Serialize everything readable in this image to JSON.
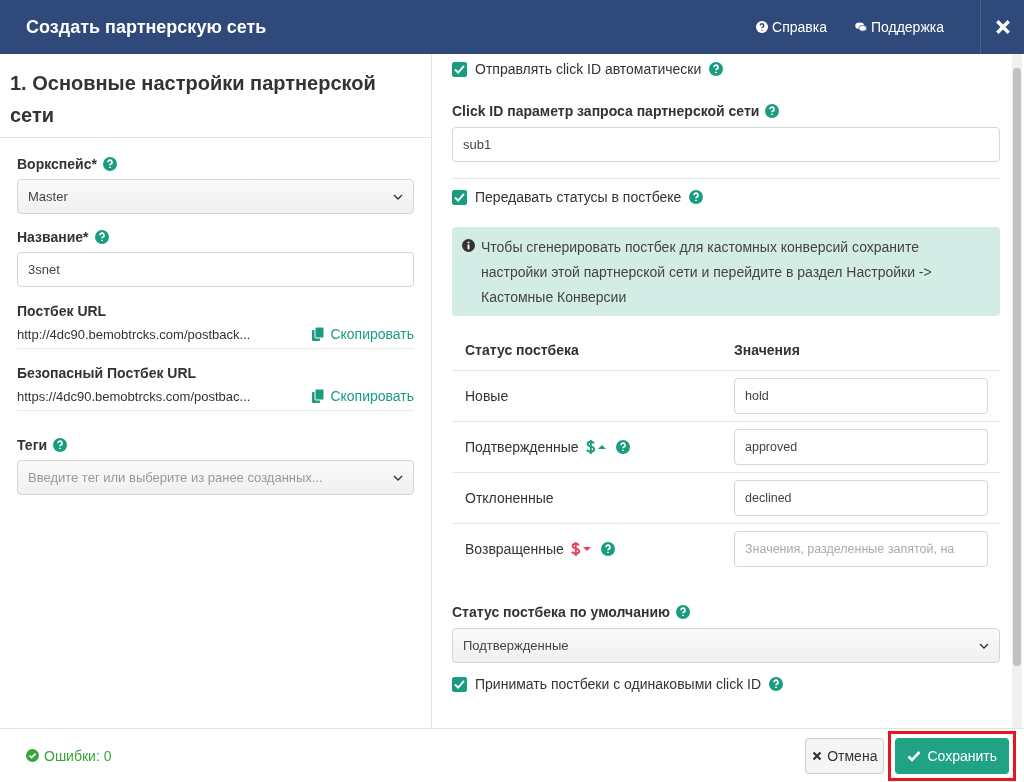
{
  "header": {
    "title": "Создать партнерскую сеть",
    "links": [
      {
        "label": "Справка",
        "kind": "help"
      },
      {
        "label": "Поддержка",
        "kind": "chat"
      }
    ]
  },
  "left": {
    "heading": "1. Основные настройки партнерской сети",
    "workspace": {
      "label": "Воркспейс*",
      "value": "Master"
    },
    "name": {
      "label": "Название*",
      "value": "3snet"
    },
    "urls": [
      {
        "label": "Постбек URL",
        "value": "http://4dc90.bemobtrcks.com/postback...",
        "copy": "Скопировать"
      },
      {
        "label": "Безопасный Постбек URL",
        "value": "https://4dc90.bemobtrcks.com/postbac...",
        "copy": "Скопировать"
      }
    ],
    "tags": {
      "label": "Теги",
      "placeholder": "Введите тег или выберите из ранее созданных..."
    }
  },
  "right": {
    "send_click_id": {
      "label": "Отправлять click ID автоматически",
      "checked": true
    },
    "click_param": {
      "label": "Click ID параметр запроса партнерской сети",
      "value": "sub1"
    },
    "pass_statuses": {
      "label": "Передавать статусы в постбеке",
      "checked": true
    },
    "info": "Чтобы сгенерировать постбек для кастомных конверсий сохраните настройки этой партнерской сети и перейдите в раздел Настройки -> Кастомные Конверсии",
    "status_table": {
      "columns": [
        "Статус постбека",
        "Значения"
      ],
      "rows": [
        {
          "label": "Новые",
          "kind": "plain",
          "value": "hold"
        },
        {
          "label": "Подтвержденные",
          "kind": "payout_up",
          "value": "approved"
        },
        {
          "label": "Отклоненные",
          "kind": "plain",
          "value": "declined"
        },
        {
          "label": "Возвращенные",
          "kind": "payout_down",
          "placeholder": "Значения, разделенные запятой, на"
        }
      ]
    },
    "default_status": {
      "label": "Статус постбека по умолчанию",
      "value": "Подтвержденные"
    },
    "accept_duplicates": {
      "label": "Принимать постбеки с одинаковыми click ID",
      "checked": true
    }
  },
  "footer": {
    "errors": "Ошибки: 0",
    "cancel": "Отмена",
    "save": {
      "label": "Сохранить",
      "highlighted": true
    }
  }
}
